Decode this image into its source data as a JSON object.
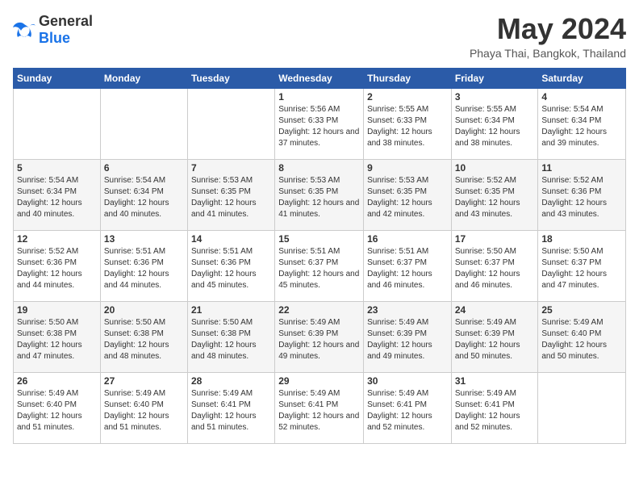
{
  "header": {
    "logo_general": "General",
    "logo_blue": "Blue",
    "month_year": "May 2024",
    "location": "Phaya Thai, Bangkok, Thailand"
  },
  "weekdays": [
    "Sunday",
    "Monday",
    "Tuesday",
    "Wednesday",
    "Thursday",
    "Friday",
    "Saturday"
  ],
  "weeks": [
    [
      {
        "day": "",
        "sunrise": "",
        "sunset": "",
        "daylight": ""
      },
      {
        "day": "",
        "sunrise": "",
        "sunset": "",
        "daylight": ""
      },
      {
        "day": "",
        "sunrise": "",
        "sunset": "",
        "daylight": ""
      },
      {
        "day": "1",
        "sunrise": "Sunrise: 5:56 AM",
        "sunset": "Sunset: 6:33 PM",
        "daylight": "Daylight: 12 hours and 37 minutes."
      },
      {
        "day": "2",
        "sunrise": "Sunrise: 5:55 AM",
        "sunset": "Sunset: 6:33 PM",
        "daylight": "Daylight: 12 hours and 38 minutes."
      },
      {
        "day": "3",
        "sunrise": "Sunrise: 5:55 AM",
        "sunset": "Sunset: 6:34 PM",
        "daylight": "Daylight: 12 hours and 38 minutes."
      },
      {
        "day": "4",
        "sunrise": "Sunrise: 5:54 AM",
        "sunset": "Sunset: 6:34 PM",
        "daylight": "Daylight: 12 hours and 39 minutes."
      }
    ],
    [
      {
        "day": "5",
        "sunrise": "Sunrise: 5:54 AM",
        "sunset": "Sunset: 6:34 PM",
        "daylight": "Daylight: 12 hours and 40 minutes."
      },
      {
        "day": "6",
        "sunrise": "Sunrise: 5:54 AM",
        "sunset": "Sunset: 6:34 PM",
        "daylight": "Daylight: 12 hours and 40 minutes."
      },
      {
        "day": "7",
        "sunrise": "Sunrise: 5:53 AM",
        "sunset": "Sunset: 6:35 PM",
        "daylight": "Daylight: 12 hours and 41 minutes."
      },
      {
        "day": "8",
        "sunrise": "Sunrise: 5:53 AM",
        "sunset": "Sunset: 6:35 PM",
        "daylight": "Daylight: 12 hours and 41 minutes."
      },
      {
        "day": "9",
        "sunrise": "Sunrise: 5:53 AM",
        "sunset": "Sunset: 6:35 PM",
        "daylight": "Daylight: 12 hours and 42 minutes."
      },
      {
        "day": "10",
        "sunrise": "Sunrise: 5:52 AM",
        "sunset": "Sunset: 6:35 PM",
        "daylight": "Daylight: 12 hours and 43 minutes."
      },
      {
        "day": "11",
        "sunrise": "Sunrise: 5:52 AM",
        "sunset": "Sunset: 6:36 PM",
        "daylight": "Daylight: 12 hours and 43 minutes."
      }
    ],
    [
      {
        "day": "12",
        "sunrise": "Sunrise: 5:52 AM",
        "sunset": "Sunset: 6:36 PM",
        "daylight": "Daylight: 12 hours and 44 minutes."
      },
      {
        "day": "13",
        "sunrise": "Sunrise: 5:51 AM",
        "sunset": "Sunset: 6:36 PM",
        "daylight": "Daylight: 12 hours and 44 minutes."
      },
      {
        "day": "14",
        "sunrise": "Sunrise: 5:51 AM",
        "sunset": "Sunset: 6:36 PM",
        "daylight": "Daylight: 12 hours and 45 minutes."
      },
      {
        "day": "15",
        "sunrise": "Sunrise: 5:51 AM",
        "sunset": "Sunset: 6:37 PM",
        "daylight": "Daylight: 12 hours and 45 minutes."
      },
      {
        "day": "16",
        "sunrise": "Sunrise: 5:51 AM",
        "sunset": "Sunset: 6:37 PM",
        "daylight": "Daylight: 12 hours and 46 minutes."
      },
      {
        "day": "17",
        "sunrise": "Sunrise: 5:50 AM",
        "sunset": "Sunset: 6:37 PM",
        "daylight": "Daylight: 12 hours and 46 minutes."
      },
      {
        "day": "18",
        "sunrise": "Sunrise: 5:50 AM",
        "sunset": "Sunset: 6:37 PM",
        "daylight": "Daylight: 12 hours and 47 minutes."
      }
    ],
    [
      {
        "day": "19",
        "sunrise": "Sunrise: 5:50 AM",
        "sunset": "Sunset: 6:38 PM",
        "daylight": "Daylight: 12 hours and 47 minutes."
      },
      {
        "day": "20",
        "sunrise": "Sunrise: 5:50 AM",
        "sunset": "Sunset: 6:38 PM",
        "daylight": "Daylight: 12 hours and 48 minutes."
      },
      {
        "day": "21",
        "sunrise": "Sunrise: 5:50 AM",
        "sunset": "Sunset: 6:38 PM",
        "daylight": "Daylight: 12 hours and 48 minutes."
      },
      {
        "day": "22",
        "sunrise": "Sunrise: 5:49 AM",
        "sunset": "Sunset: 6:39 PM",
        "daylight": "Daylight: 12 hours and 49 minutes."
      },
      {
        "day": "23",
        "sunrise": "Sunrise: 5:49 AM",
        "sunset": "Sunset: 6:39 PM",
        "daylight": "Daylight: 12 hours and 49 minutes."
      },
      {
        "day": "24",
        "sunrise": "Sunrise: 5:49 AM",
        "sunset": "Sunset: 6:39 PM",
        "daylight": "Daylight: 12 hours and 50 minutes."
      },
      {
        "day": "25",
        "sunrise": "Sunrise: 5:49 AM",
        "sunset": "Sunset: 6:40 PM",
        "daylight": "Daylight: 12 hours and 50 minutes."
      }
    ],
    [
      {
        "day": "26",
        "sunrise": "Sunrise: 5:49 AM",
        "sunset": "Sunset: 6:40 PM",
        "daylight": "Daylight: 12 hours and 51 minutes."
      },
      {
        "day": "27",
        "sunrise": "Sunrise: 5:49 AM",
        "sunset": "Sunset: 6:40 PM",
        "daylight": "Daylight: 12 hours and 51 minutes."
      },
      {
        "day": "28",
        "sunrise": "Sunrise: 5:49 AM",
        "sunset": "Sunset: 6:41 PM",
        "daylight": "Daylight: 12 hours and 51 minutes."
      },
      {
        "day": "29",
        "sunrise": "Sunrise: 5:49 AM",
        "sunset": "Sunset: 6:41 PM",
        "daylight": "Daylight: 12 hours and 52 minutes."
      },
      {
        "day": "30",
        "sunrise": "Sunrise: 5:49 AM",
        "sunset": "Sunset: 6:41 PM",
        "daylight": "Daylight: 12 hours and 52 minutes."
      },
      {
        "day": "31",
        "sunrise": "Sunrise: 5:49 AM",
        "sunset": "Sunset: 6:41 PM",
        "daylight": "Daylight: 12 hours and 52 minutes."
      },
      {
        "day": "",
        "sunrise": "",
        "sunset": "",
        "daylight": ""
      }
    ]
  ]
}
